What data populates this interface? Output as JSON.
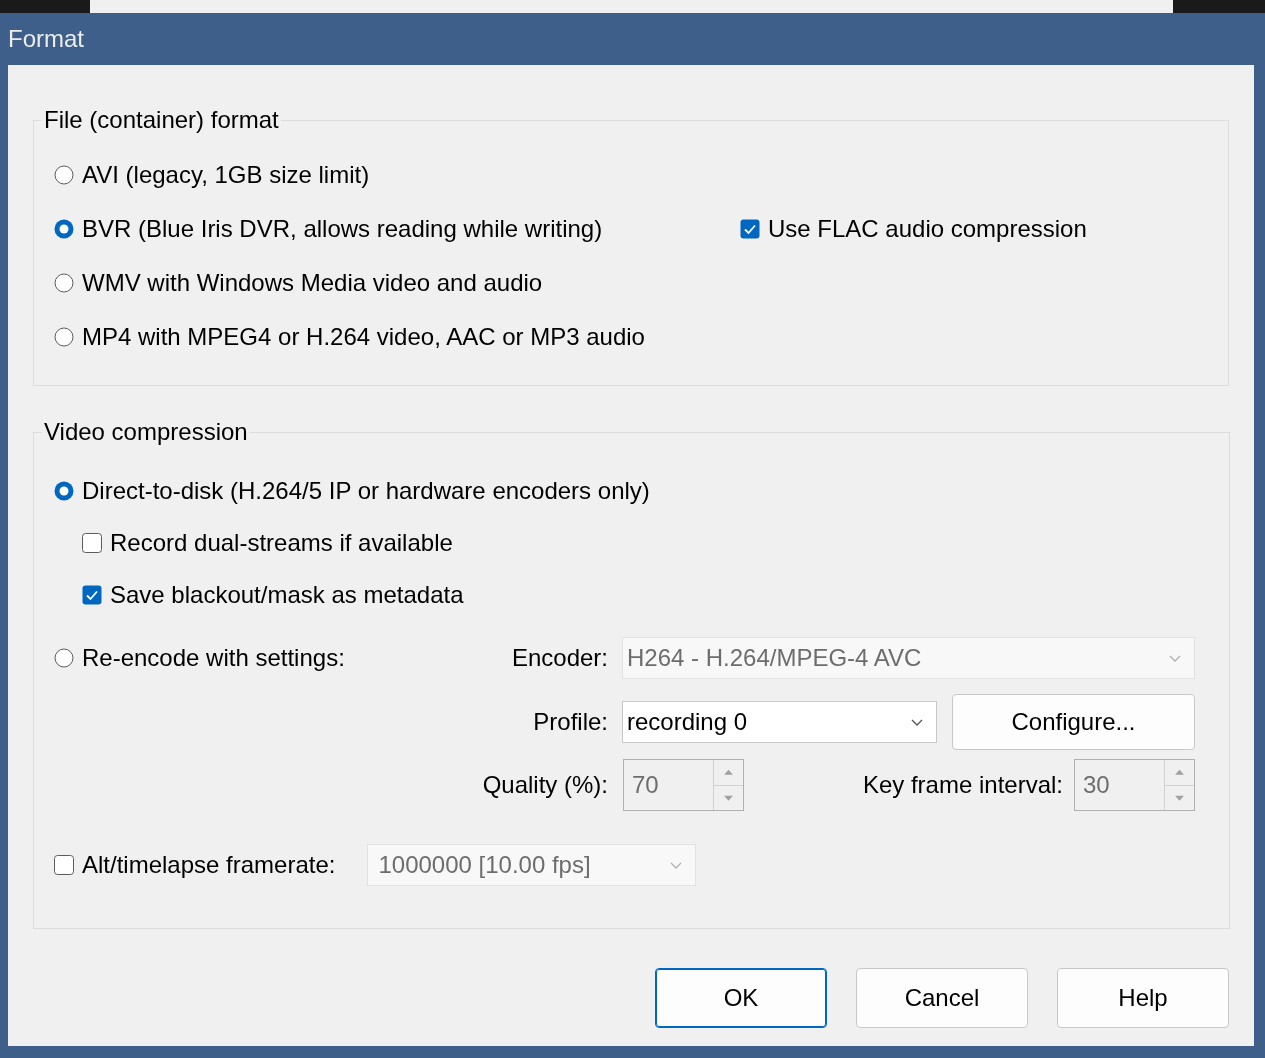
{
  "window": {
    "title": "Format"
  },
  "file_format": {
    "title": "File (container) format",
    "options": [
      {
        "label": "AVI (legacy, 1GB size limit)",
        "selected": false
      },
      {
        "label": "BVR (Blue Iris DVR, allows reading while writing)",
        "selected": true
      },
      {
        "label": "WMV with Windows Media video and audio",
        "selected": false
      },
      {
        "label": "MP4 with MPEG4 or H.264 video, AAC or MP3 audio",
        "selected": false
      }
    ],
    "flac": {
      "label": "Use FLAC audio compression",
      "checked": true
    }
  },
  "video_compression": {
    "title": "Video compression",
    "direct": {
      "label": "Direct-to-disk (H.264/5 IP or hardware encoders only)",
      "selected": true
    },
    "dual_streams": {
      "label": "Record dual-streams if available",
      "checked": false
    },
    "blackout": {
      "label": "Save blackout/mask as metadata",
      "checked": true
    },
    "reencode": {
      "label": "Re-encode with settings:",
      "selected": false
    },
    "encoder": {
      "label": "Encoder:",
      "value": "H264 - H.264/MPEG-4 AVC",
      "disabled": true
    },
    "profile": {
      "label": "Profile:",
      "value": "recording 0",
      "disabled": false
    },
    "configure": "Configure...",
    "quality": {
      "label": "Quality (%):",
      "value": "70",
      "disabled": true
    },
    "key_frame": {
      "label": "Key frame interval:",
      "value": "30",
      "disabled": true
    },
    "alt_framerate": {
      "label": "Alt/timelapse framerate:",
      "checked": false,
      "value": "1000000 [10.00 fps]",
      "disabled": true
    }
  },
  "buttons": [
    {
      "label": "OK",
      "default": true
    },
    {
      "label": "Cancel",
      "default": false
    },
    {
      "label": "Help",
      "default": false
    }
  ]
}
